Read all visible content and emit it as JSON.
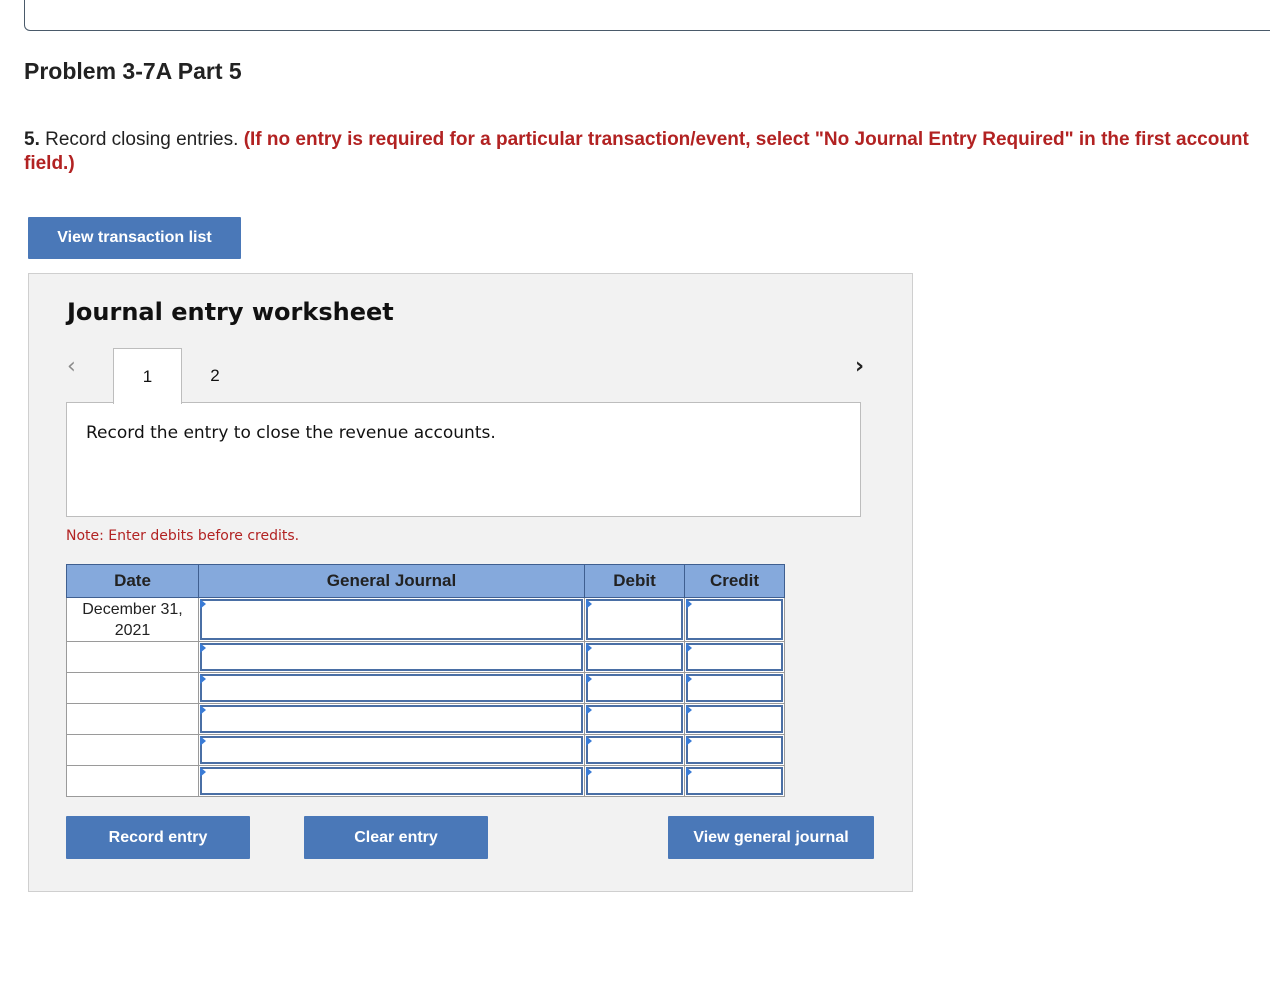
{
  "header": {
    "title": "Problem 3-7A Part 5"
  },
  "instructions": {
    "number": "5.",
    "text": " Record closing entries. ",
    "note": "(If no entry is required for a particular transaction/event, select \"No Journal Entry Required\" in the first account field.)"
  },
  "buttons": {
    "view_transaction_list": "View transaction list",
    "record_entry": "Record entry",
    "clear_entry": "Clear entry",
    "view_general_journal": "View general journal"
  },
  "worksheet": {
    "title": "Journal entry worksheet",
    "tabs": [
      {
        "label": "1"
      },
      {
        "label": "2"
      }
    ],
    "active_tab": "1",
    "description": "Record the entry to close the revenue accounts.",
    "note": "Note: Enter debits before credits."
  },
  "table": {
    "headers": {
      "date": "Date",
      "general_journal": "General Journal",
      "debit": "Debit",
      "credit": "Credit"
    },
    "rows": [
      {
        "date": "December 31, 2021",
        "account": "",
        "debit": "",
        "credit": ""
      },
      {
        "date": "",
        "account": "",
        "debit": "",
        "credit": ""
      },
      {
        "date": "",
        "account": "",
        "debit": "",
        "credit": ""
      },
      {
        "date": "",
        "account": "",
        "debit": "",
        "credit": ""
      },
      {
        "date": "",
        "account": "",
        "debit": "",
        "credit": ""
      },
      {
        "date": "",
        "account": "",
        "debit": "",
        "credit": ""
      }
    ]
  },
  "colors": {
    "button_bg": "#4a78b8",
    "header_bg": "#85a9dc",
    "instruction_red": "#b22222",
    "panel_bg": "#f2f2f2"
  }
}
